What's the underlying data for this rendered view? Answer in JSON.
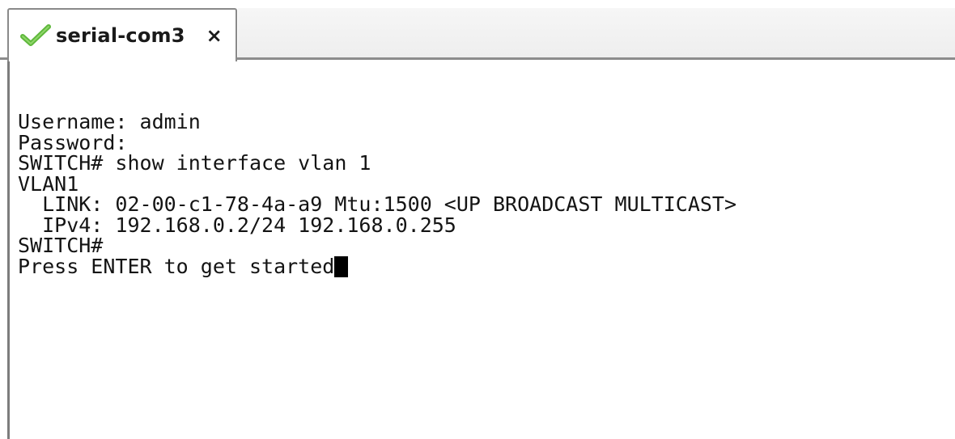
{
  "tab": {
    "title": "serial-com3",
    "close_glyph": "×",
    "status_icon": "check-icon",
    "status_color": "#5fb83c"
  },
  "terminal": {
    "lines": [
      "Username: admin",
      "Password:",
      "SWITCH# show interface vlan 1",
      "VLAN1",
      "  LINK: 02-00-c1-78-4a-a9 Mtu:1500 <UP BROADCAST MULTICAST>",
      "  IPv4: 192.168.0.2/24 192.168.0.255",
      "SWITCH#",
      "Press ENTER to get started"
    ]
  }
}
